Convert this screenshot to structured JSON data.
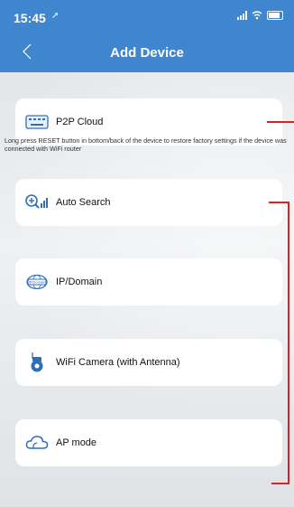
{
  "status_bar": {
    "time": "15:45"
  },
  "nav": {
    "title": "Add Device"
  },
  "cards": {
    "p2p": "P2P Cloud",
    "auto_search": "Auto Search",
    "ip_domain": "IP/Domain",
    "wifi_camera": "WiFi Camera (with Antenna)",
    "ap_mode": "AP mode"
  },
  "note": "Long press RESET button in bottom/back of the device to restore factory settings if the device was connected with WiFi router",
  "icons": {
    "p2p": "keyboard-icon",
    "auto_search": "search-signal-icon",
    "ip_domain": "ip-domain-icon",
    "wifi_camera": "camera-icon",
    "ap_mode": "cloud-icon"
  },
  "colors": {
    "header": "#3f86cf",
    "annotation": "#d8232a"
  }
}
